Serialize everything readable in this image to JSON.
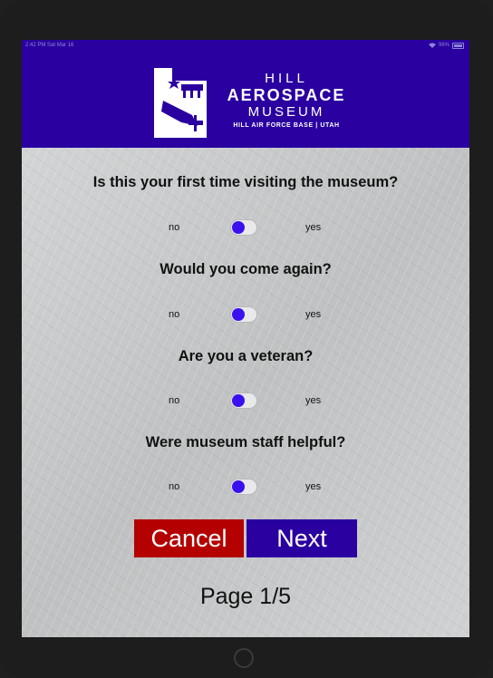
{
  "status_bar": {
    "time": "2:42 PM",
    "date": "Sat Mar 16",
    "battery": "96%"
  },
  "header": {
    "logo_line1": "HILL",
    "logo_line2": "AEROSPACE",
    "logo_line3": "MUSEUM",
    "logo_line4": "HILL AIR FORCE BASE | UTAH",
    "background": "#2a00a0"
  },
  "questions": [
    {
      "text": "Is this your first time visiting the museum?",
      "no_label": "no",
      "yes_label": "yes",
      "value": "no"
    },
    {
      "text": "Would you come again?",
      "no_label": "no",
      "yes_label": "yes",
      "value": "no"
    },
    {
      "text": "Are you a veteran?",
      "no_label": "no",
      "yes_label": "yes",
      "value": "no"
    },
    {
      "text": "Were museum staff helpful?",
      "no_label": "no",
      "yes_label": "yes",
      "value": "no"
    }
  ],
  "buttons": {
    "cancel": "Cancel",
    "next": "Next"
  },
  "page_indicator": "Page 1/5",
  "colors": {
    "cancel": "#b40000",
    "next": "#2a00a0",
    "toggle_knob": "#3b10f0"
  },
  "icons": {
    "logo": "plane-silhouette-logo",
    "wifi": "wifi-icon",
    "battery": "battery-icon"
  }
}
